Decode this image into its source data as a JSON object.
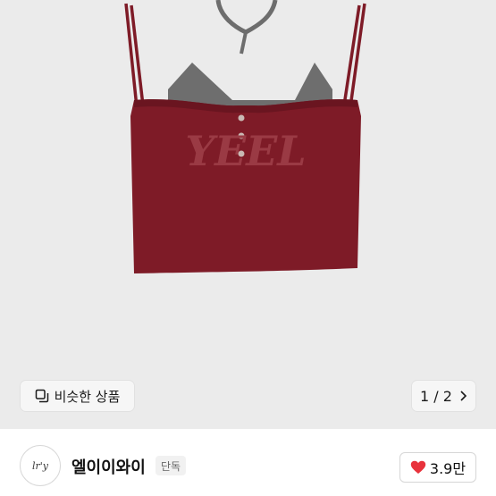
{
  "similar_button": {
    "label": "비슷한 상품",
    "icon": "copy-icon"
  },
  "pager": {
    "text": "1 / 2",
    "icon": "chevron-right-icon"
  },
  "product_image": {
    "garment_print": "YEEL"
  },
  "shop": {
    "avatar_text": "lr'y",
    "name": "엘이이와이",
    "badge": "단독"
  },
  "like": {
    "count": "3.9만",
    "icon": "heart-icon",
    "color": "#e8323c"
  },
  "colors": {
    "garment": "#7e1b27",
    "strap_grey": "#6d6d6d",
    "hero_bg": "#ebebeb"
  }
}
